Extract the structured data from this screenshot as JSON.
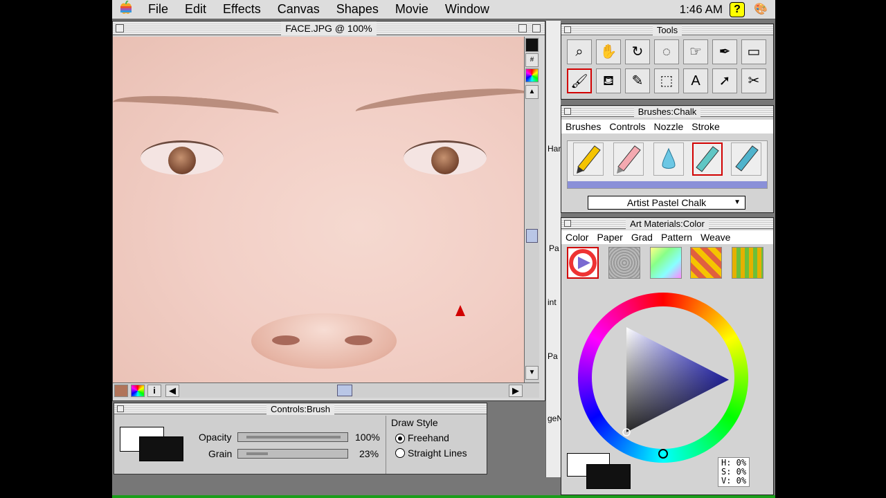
{
  "menubar": {
    "apple": "",
    "items": [
      "File",
      "Edit",
      "Effects",
      "Canvas",
      "Shapes",
      "Movie",
      "Window"
    ],
    "clock": "1:46 AM",
    "help": "?"
  },
  "document": {
    "title": "FACE.JPG @ 100%"
  },
  "tools": {
    "title": "Tools",
    "items": [
      {
        "name": "magnifier-tool",
        "glyph": "⌕"
      },
      {
        "name": "grabber-tool",
        "glyph": "✋"
      },
      {
        "name": "rotate-page-tool",
        "glyph": "↻"
      },
      {
        "name": "lasso-tool",
        "glyph": "◌"
      },
      {
        "name": "crop-tool",
        "glyph": "☞"
      },
      {
        "name": "pen-tool",
        "glyph": "✒"
      },
      {
        "name": "rectangle-tool",
        "glyph": "▭"
      },
      {
        "name": "brush-tool",
        "glyph": "🖌"
      },
      {
        "name": "paint-bucket-tool",
        "glyph": "⛾"
      },
      {
        "name": "dropper-tool",
        "glyph": "✎"
      },
      {
        "name": "rectangular-selection-tool",
        "glyph": "⬚"
      },
      {
        "name": "text-tool",
        "glyph": "A"
      },
      {
        "name": "selector-tool",
        "glyph": "➚"
      },
      {
        "name": "scissors-tool",
        "glyph": "✂"
      }
    ]
  },
  "brushes": {
    "title": "Brushes:Chalk",
    "tabs": [
      "Brushes",
      "Controls",
      "Nozzle",
      "Stroke"
    ],
    "variant": "Artist Pastel Chalk"
  },
  "art_materials": {
    "title": "Art Materials:Color",
    "tabs": [
      "Color",
      "Paper",
      "Grad",
      "Pattern",
      "Weave"
    ],
    "hsv": [
      "H: 0%",
      "S: 0%",
      "V: 0%"
    ],
    "colors": {
      "primary": "#ffffff",
      "secondary": "#111111"
    }
  },
  "controls": {
    "title": "Controls:Brush",
    "opacity_label": "Opacity",
    "opacity_value": "100%",
    "opacity_level": 1.0,
    "grain_label": "Grain",
    "grain_value": "23%",
    "grain_level": 0.23,
    "draw_style_label": "Draw Style",
    "freehand": "Freehand",
    "straight": "Straight Lines",
    "colors": {
      "primary": "#ffffff",
      "secondary": "#111111"
    }
  },
  "side_strip": [
    "Han",
    "Pa",
    "int",
    "Pa",
    "geN"
  ]
}
